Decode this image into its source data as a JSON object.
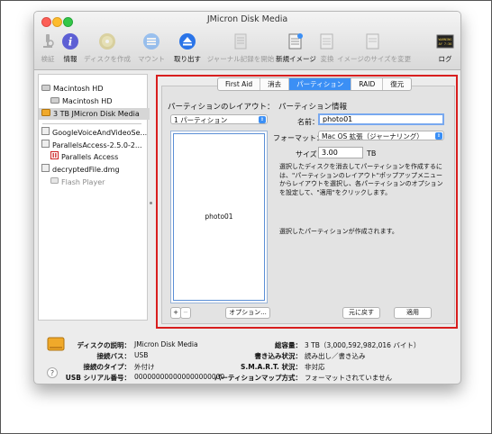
{
  "window": {
    "title": "JMicron Disk Media"
  },
  "toolbar": {
    "items": [
      {
        "label": "検証",
        "icon": "microscope-icon"
      },
      {
        "label": "情報",
        "icon": "info-icon"
      },
      {
        "label": "ディスクを作成",
        "icon": "burn-icon"
      },
      {
        "label": "マウント",
        "icon": "mount-icon"
      },
      {
        "label": "取り出す",
        "icon": "eject-icon"
      },
      {
        "label": "ジャーナル記録を開始",
        "icon": "journal-icon"
      },
      {
        "label": "新規イメージ",
        "icon": "new-image-icon"
      },
      {
        "label": "変換",
        "icon": "convert-icon"
      },
      {
        "label": "イメージのサイズを変更",
        "icon": "resize-image-icon"
      },
      {
        "label": "ログ",
        "icon": "log-icon"
      }
    ],
    "log_badge": "WARNING\nAY 7:36"
  },
  "sidebar": {
    "items": [
      {
        "label": "Macintosh HD"
      },
      {
        "label": "Macintosh HD"
      },
      {
        "label": "3 TB JMicron Disk Media"
      },
      {
        "label": "GoogleVoiceAndVideoSe..."
      },
      {
        "label": "ParallelsAccess-2.5.0-2..."
      },
      {
        "label": "Parallels Access"
      },
      {
        "label": "decryptedFile.dmg"
      },
      {
        "label": "Flash Player"
      }
    ]
  },
  "tabs": [
    {
      "label": "First Aid"
    },
    {
      "label": "消去"
    },
    {
      "label": "パーティション"
    },
    {
      "label": "RAID"
    },
    {
      "label": "復元"
    }
  ],
  "partition": {
    "layout_heading": "パーティションのレイアウト：",
    "layout_select": "1 パーティション",
    "info_heading": "パーティション情報",
    "name_label": "名前：",
    "name_value": "photo01",
    "format_label": "フォーマット：",
    "format_value": "Mac OS 拡張（ジャーナリング）",
    "size_label": "サイズ：",
    "size_value": "3.00",
    "size_unit": "TB",
    "partition_name": "photo01",
    "description": "選択したディスクを消去してパーティションを作成するには、\"パーティションのレイアウト\"ポップアップメニューからレイアウトを選択し、各パーティションのオプションを設定して、\"適用\"をクリックします。",
    "selected_msg": "選択したパーティションが作成されます。",
    "add_label": "+",
    "remove_label": "−",
    "options_label": "オプション...",
    "revert_label": "元に戻す",
    "apply_label": "適用"
  },
  "info": {
    "desc_label": "ディスクの説明：",
    "desc_value": "JMicron Disk Media",
    "bus_label": "接続バス：",
    "bus_value": "USB",
    "type_label": "接続のタイプ：",
    "type_value": "外付け",
    "serial_label": "USB シリアル番号：",
    "serial_value": "000000000000000000000",
    "capacity_label": "総容量：",
    "capacity_value": "3 TB（3,000,592,982,016 バイト）",
    "write_label": "書き込み状況：",
    "write_value": "読み出し／書き込み",
    "smart_label": "S.M.A.R.T. 状況：",
    "smart_value": "非対応",
    "map_label": "パーティションマップ方式：",
    "map_value": "フォーマットされていません"
  }
}
